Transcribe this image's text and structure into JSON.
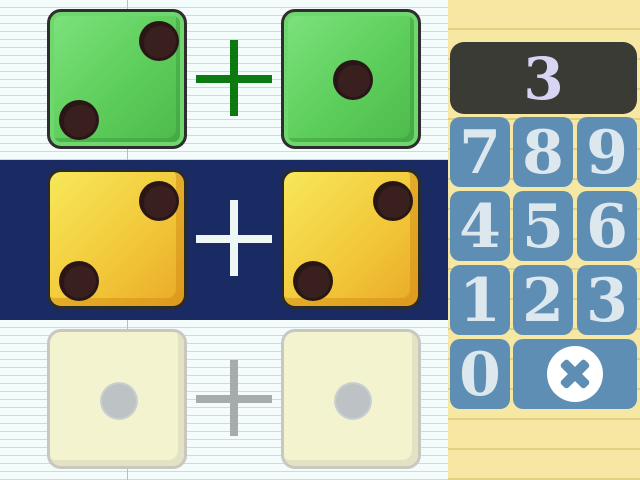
{
  "rows": [
    {
      "state": "answered",
      "left_die": {
        "value": 2,
        "color": "#5ccd5a"
      },
      "right_die": {
        "value": 1,
        "color": "#5ccd5a"
      },
      "operator": "plus-icon"
    },
    {
      "state": "active",
      "left_die": {
        "value": 2,
        "color": "#f2c93a"
      },
      "right_die": {
        "value": 2,
        "color": "#f2c93a"
      },
      "operator": "plus-icon",
      "highlight_color": "#1a2a63"
    },
    {
      "state": "upcoming",
      "left_die": {
        "value": 1,
        "color": "#f4f3cf"
      },
      "right_die": {
        "value": 1,
        "color": "#f4f3cf"
      },
      "operator": "plus-icon"
    }
  ],
  "keypad": {
    "display": "3",
    "keys": [
      "7",
      "8",
      "9",
      "4",
      "5",
      "6",
      "1",
      "2",
      "3",
      "0"
    ],
    "clear_icon": "clear-icon"
  },
  "colors": {
    "paper": "#f3fbfb",
    "notepad": "#f6e7a3",
    "key": "#5f8eb5",
    "display": "#3b3b36"
  }
}
